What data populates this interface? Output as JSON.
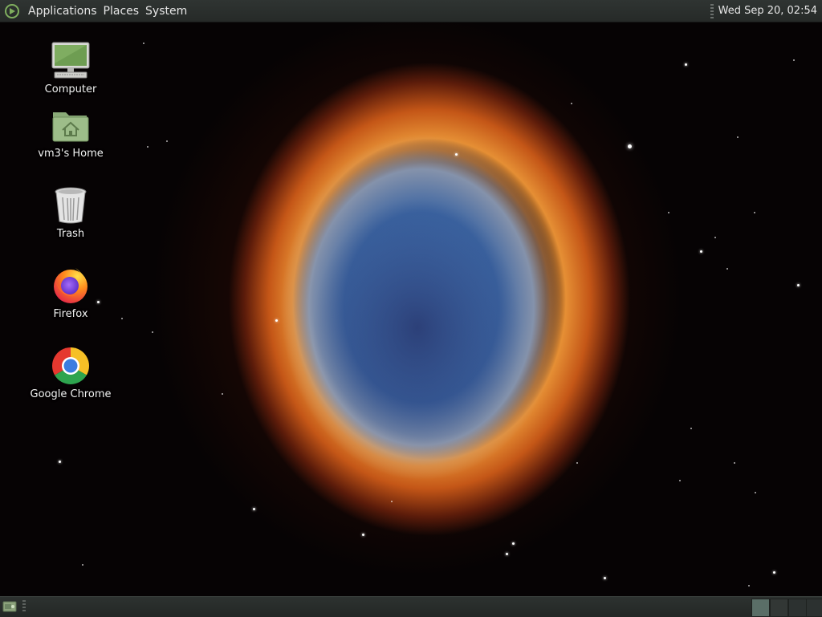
{
  "top_panel": {
    "menus": [
      "Applications",
      "Places",
      "System"
    ],
    "clock": "Wed Sep 20, 02:54"
  },
  "desktop": {
    "icons": [
      {
        "label": "Computer",
        "icon": "computer-icon"
      },
      {
        "label": "vm3's Home",
        "icon": "home-folder-icon"
      },
      {
        "label": "Trash",
        "icon": "trash-icon"
      },
      {
        "label": "Firefox",
        "icon": "firefox-icon"
      },
      {
        "label": "Google Chrome",
        "icon": "chrome-icon"
      }
    ]
  },
  "bottom_panel": {
    "show_desktop_icon": "show-desktop-icon",
    "workspaces": 4,
    "active_workspace": 1
  },
  "colors": {
    "panel_bg": "#2b2f2d",
    "active_workspace": "#5a6e67"
  }
}
